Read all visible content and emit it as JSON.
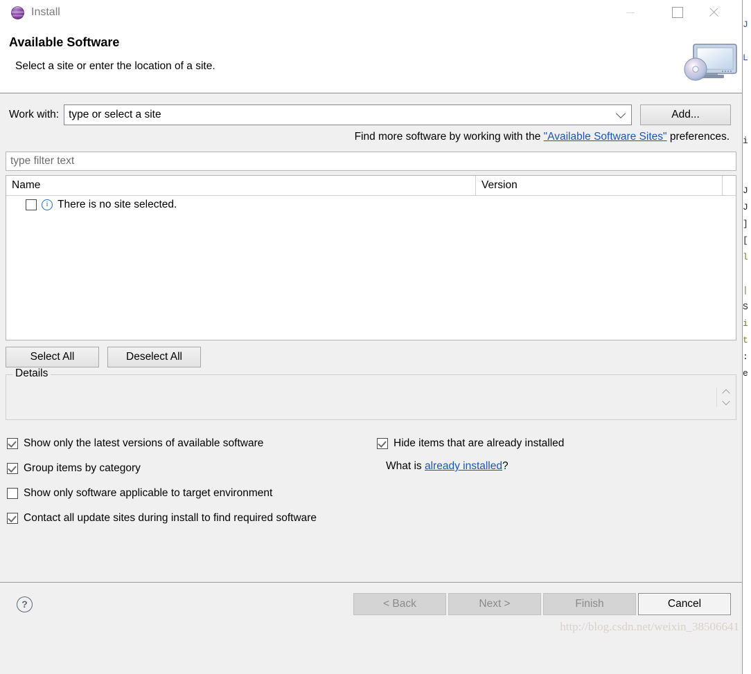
{
  "window": {
    "title": "Install",
    "app_icon": "eclipse-sphere-icon",
    "minimize_label": "Minimize",
    "maximize_label": "Maximize",
    "close_label": "Close"
  },
  "banner": {
    "title": "Available Software",
    "subtitle": "Select a site or enter the location of a site.",
    "art_icon": "monitor-with-disc-icon"
  },
  "work_with": {
    "label": "Work with:",
    "value": "type or select a site",
    "placeholder": "type or select a site",
    "dropdown_icon": "chevron-down-icon",
    "add_button": "Add..."
  },
  "hint": {
    "prefix": "Find more software by working with the ",
    "link": "\"Available Software Sites\"",
    "suffix": " preferences."
  },
  "filter": {
    "placeholder": "type filter text",
    "value": ""
  },
  "table": {
    "columns": [
      "Name",
      "Version"
    ],
    "rows": [
      {
        "checked": false,
        "icon": "info-icon",
        "name": "There is no site selected.",
        "version": ""
      }
    ]
  },
  "selection_buttons": {
    "select_all": "Select All",
    "deselect_all": "Deselect All"
  },
  "details": {
    "legend": "Details",
    "content": "",
    "spinner_up_icon": "chevron-up-icon",
    "spinner_down_icon": "chevron-down-icon"
  },
  "options": {
    "left": [
      {
        "label": "Show only the latest versions of available software",
        "checked": true
      },
      {
        "label": "Group items by category",
        "checked": true
      },
      {
        "label": "Show only software applicable to target environment",
        "checked": false
      },
      {
        "label": "Contact all update sites during install to find required software",
        "checked": true
      }
    ],
    "right": [
      {
        "label": "Hide items that are already installed",
        "checked": true
      }
    ],
    "what_is": {
      "prefix": "What is ",
      "link": "already installed",
      "suffix": "?"
    }
  },
  "footer": {
    "help_icon": "help-question-icon",
    "buttons": [
      {
        "label": "< Back",
        "enabled": false
      },
      {
        "label": "Next >",
        "enabled": false
      },
      {
        "label": "Finish",
        "enabled": false
      },
      {
        "label": "Cancel",
        "enabled": true
      }
    ]
  },
  "watermark": "http://blog.csdn.net/weixin_38506641",
  "colors": {
    "dialog_background": "#f0f0f0",
    "header_background": "#ffffff",
    "link": "#1b56b5",
    "info_icon": "#1b6fc2",
    "title_text": "#7b7b7b"
  }
}
